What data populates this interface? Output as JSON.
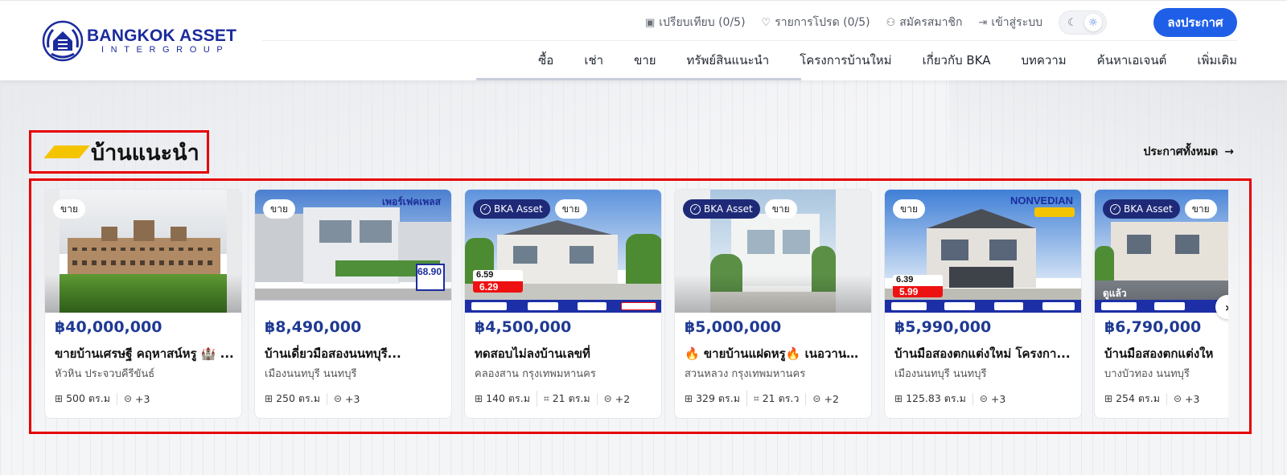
{
  "header": {
    "logo_title": "BANGKOK ASSET",
    "logo_sub": "INTERGROUP",
    "utility": [
      {
        "icon": "clipboard-icon",
        "label": "เปรียบเทียบ (0/5)"
      },
      {
        "icon": "heart-icon",
        "label": "รายการโปรด (0/5)"
      },
      {
        "icon": "user-plus-icon",
        "label": "สมัครสมาชิก"
      },
      {
        "icon": "login-icon",
        "label": "เข้าสู่ระบบ"
      }
    ],
    "post_button": "ลงประกาศ",
    "nav": [
      "ซื้อ",
      "เช่า",
      "ขาย",
      "ทรัพย์สินแนะนำ",
      "โครงการบ้านใหม่",
      "เกี่ยวกับ BKA",
      "บทความ",
      "ค้นหาเอเจนต์",
      "เพิ่มเติม"
    ]
  },
  "section": {
    "title": "บ้านแนะนำ",
    "see_all": "ประกาศทั้งหมด"
  },
  "colors": {
    "brand_blue": "#1b2b9c",
    "button_blue": "#1f5fe8",
    "price_blue": "#1f3a93",
    "accent_yellow": "#f5c400",
    "highlight_red": "#e60000"
  },
  "cards": [
    {
      "badges": {
        "bka": "",
        "sale": "ขาย"
      },
      "price": "฿40,000,000",
      "title": "ขายบ้านเศรษฐี คฤหาสน์หรู 🏰 ...",
      "location": "หัวหิน ประจวบคีรีขันธ์",
      "specs": [
        {
          "icon": "area-icon",
          "value": "500 ตร.ม"
        },
        {
          "icon": "more-icon",
          "value": "+3"
        }
      ],
      "image_text": {
        "top": "",
        "price_top": "",
        "price_bottom": "",
        "extra": ""
      }
    },
    {
      "badges": {
        "bka": "",
        "sale": "ขาย"
      },
      "price": "฿8,490,000",
      "title": "บ้านเดี่ยวมือสองนนทบุรี...",
      "location": "เมืองนนทบุรี นนทบุรี",
      "specs": [
        {
          "icon": "area-icon",
          "value": "250 ตร.ม"
        },
        {
          "icon": "more-icon",
          "value": "+3"
        }
      ],
      "image_text": {
        "top": "เพอร์เฟคเพลส",
        "price_top": "68.90",
        "price_bottom": "",
        "extra": ""
      }
    },
    {
      "badges": {
        "bka": "BKA Asset",
        "sale": "ขาย"
      },
      "price": "฿4,500,000",
      "title": "ทดสอบไม่ลงบ้านเลขที่",
      "location": "คลองสาน กรุงเทพมหานคร",
      "specs": [
        {
          "icon": "area-icon",
          "value": "140 ตร.ม"
        },
        {
          "icon": "land-icon",
          "value": "21 ตร.ม"
        },
        {
          "icon": "more-icon",
          "value": "+2"
        }
      ],
      "image_text": {
        "top": "",
        "price_top": "6.59",
        "price_bottom": "6.29",
        "extra": ""
      }
    },
    {
      "badges": {
        "bka": "BKA Asset",
        "sale": "ขาย"
      },
      "price": "฿5,000,000",
      "title": "🔥 ขายบ้านแฝดหรู🔥 เนอวานา...",
      "location": "สวนหลวง กรุงเทพมหานคร",
      "specs": [
        {
          "icon": "area-icon",
          "value": "329 ตร.ม"
        },
        {
          "icon": "land-icon",
          "value": "21 ตร.ว"
        },
        {
          "icon": "more-icon",
          "value": "+2"
        }
      ],
      "image_text": {
        "top": "",
        "price_top": "",
        "price_bottom": "",
        "extra": ""
      }
    },
    {
      "badges": {
        "bka": "",
        "sale": "ขาย"
      },
      "price": "฿5,990,000",
      "title": "บ้านมือสองตกแต่งใหม่ โครงกา...",
      "location": "เมืองนนทบุรี นนทบุรี",
      "specs": [
        {
          "icon": "area-icon",
          "value": "125.83 ตร.ม"
        },
        {
          "icon": "more-icon",
          "value": "+3"
        }
      ],
      "image_text": {
        "top": "NONVEDIAN",
        "price_top": "6.39",
        "price_bottom": "5.99",
        "extra": ""
      }
    },
    {
      "badges": {
        "bka": "BKA Asset",
        "sale": "ขาย"
      },
      "price": "฿6,790,000",
      "title": "บ้านมือสองตกแต่งให",
      "location": "บางบัวทอง นนทบุรี",
      "specs": [
        {
          "icon": "area-icon",
          "value": "254 ตร.ม"
        },
        {
          "icon": "more-icon",
          "value": "+3"
        }
      ],
      "image_text": {
        "top": "",
        "price_top": "",
        "price_bottom": "",
        "extra": "ดูแล้ว"
      }
    }
  ]
}
